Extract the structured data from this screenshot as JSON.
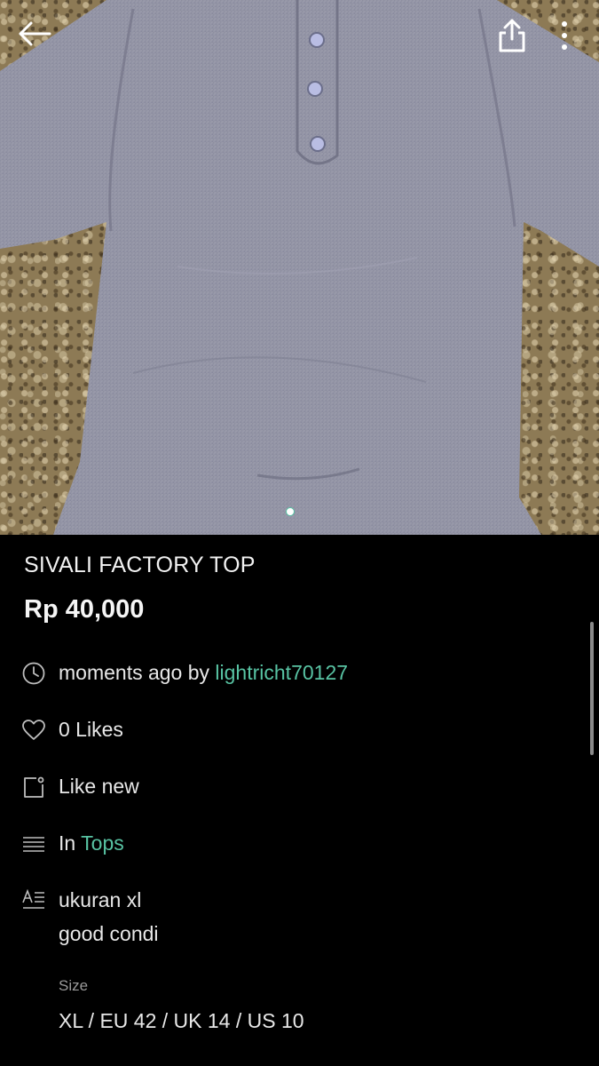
{
  "listing": {
    "title": "SIVALI FACTORY TOP",
    "price": "Rp 40,000",
    "posted_time": "moments ago by ",
    "seller": "lightricht70127",
    "likes": "0 Likes",
    "condition": "Like new",
    "category_prefix": "In ",
    "category": "Tops",
    "description_lines": [
      "ukuran xl",
      "good condi"
    ],
    "size_label": "Size",
    "size_value": "XL / EU 42 / UK 14 / US 10"
  },
  "gallery": {
    "current_page": 1,
    "total_pages": 1
  },
  "icons": {
    "back": "arrow-left-icon",
    "share": "share-icon",
    "more": "more-vertical-icon",
    "time": "clock-icon",
    "likes": "heart-icon",
    "condition": "tag-icon",
    "category": "list-icon",
    "description": "text-icon"
  },
  "colors": {
    "accent": "#58c3a3",
    "background": "#000000",
    "text": "#e8e8e8"
  }
}
